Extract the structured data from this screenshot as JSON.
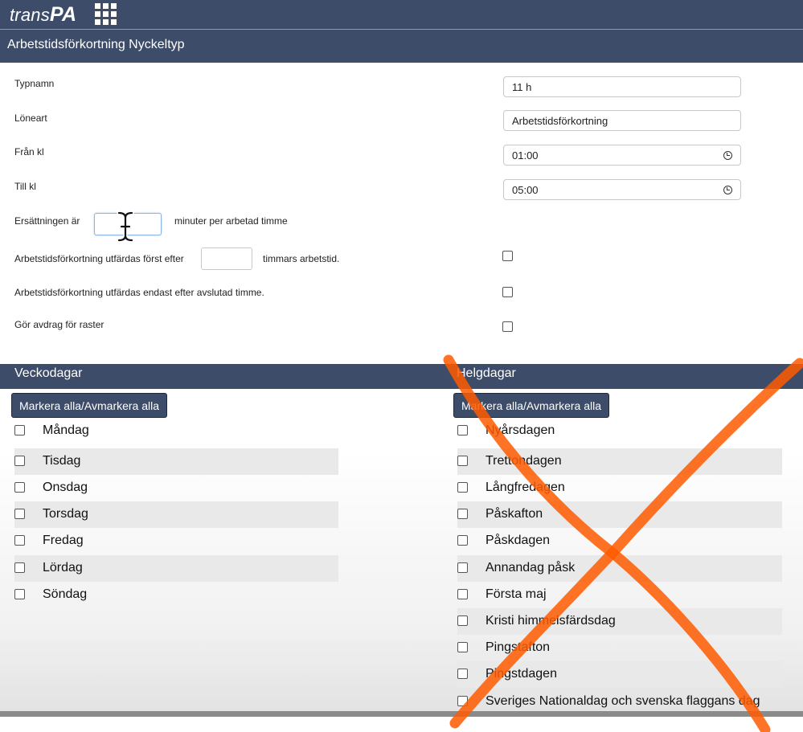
{
  "app": {
    "logo_text": "trans",
    "logo_bold": "PA",
    "apps_icon": "grid-icon"
  },
  "page": {
    "title": "Arbetstidsförkortning Nyckeltyp"
  },
  "form": {
    "typnamn": {
      "label": "Typnamn",
      "value": "11 h"
    },
    "loneart": {
      "label": "Löneart",
      "value": "Arbetstidsförkortning"
    },
    "fran_kl": {
      "label": "Från kl",
      "value": "01:00",
      "icon": "clock-icon"
    },
    "till_kl": {
      "label": "Till kl",
      "value": "05:00",
      "icon": "clock-icon"
    },
    "ersattning": {
      "label_before": "Ersättningen är",
      "label_after": "minuter per arbetad timme",
      "value": ""
    },
    "forst_efter": {
      "label_before": "Arbetstidsförkortning utfärdas först efter",
      "label_after": "timmars arbetstid.",
      "value": "",
      "checked": false
    },
    "endast_efter": {
      "label": "Arbetstidsförkortning utfärdas endast efter avslutad timme.",
      "checked": false
    },
    "raster": {
      "label": "Gör avdrag för raster",
      "checked": false
    }
  },
  "weekdays": {
    "title": "Veckodagar",
    "toggle_all": "Markera alla/Avmarkera alla",
    "items": [
      "Måndag",
      "Tisdag",
      "Onsdag",
      "Torsdag",
      "Fredag",
      "Lördag",
      "Söndag"
    ]
  },
  "holidays": {
    "title": "Helgdagar",
    "toggle_all": "Markera alla/Avmarkera alla",
    "items": [
      "Nyårsdagen",
      "Trettondagen",
      "Långfredagen",
      "Påskafton",
      "Påskdagen",
      "Annandag påsk",
      "Första maj",
      "Kristi himmelsfärdsdag",
      "Pingstafton",
      "Pingstdagen",
      "Sveriges Nationaldag och svenska flaggans dag"
    ]
  },
  "overlay": {
    "color": "#ff5a00",
    "shape": "cross"
  }
}
